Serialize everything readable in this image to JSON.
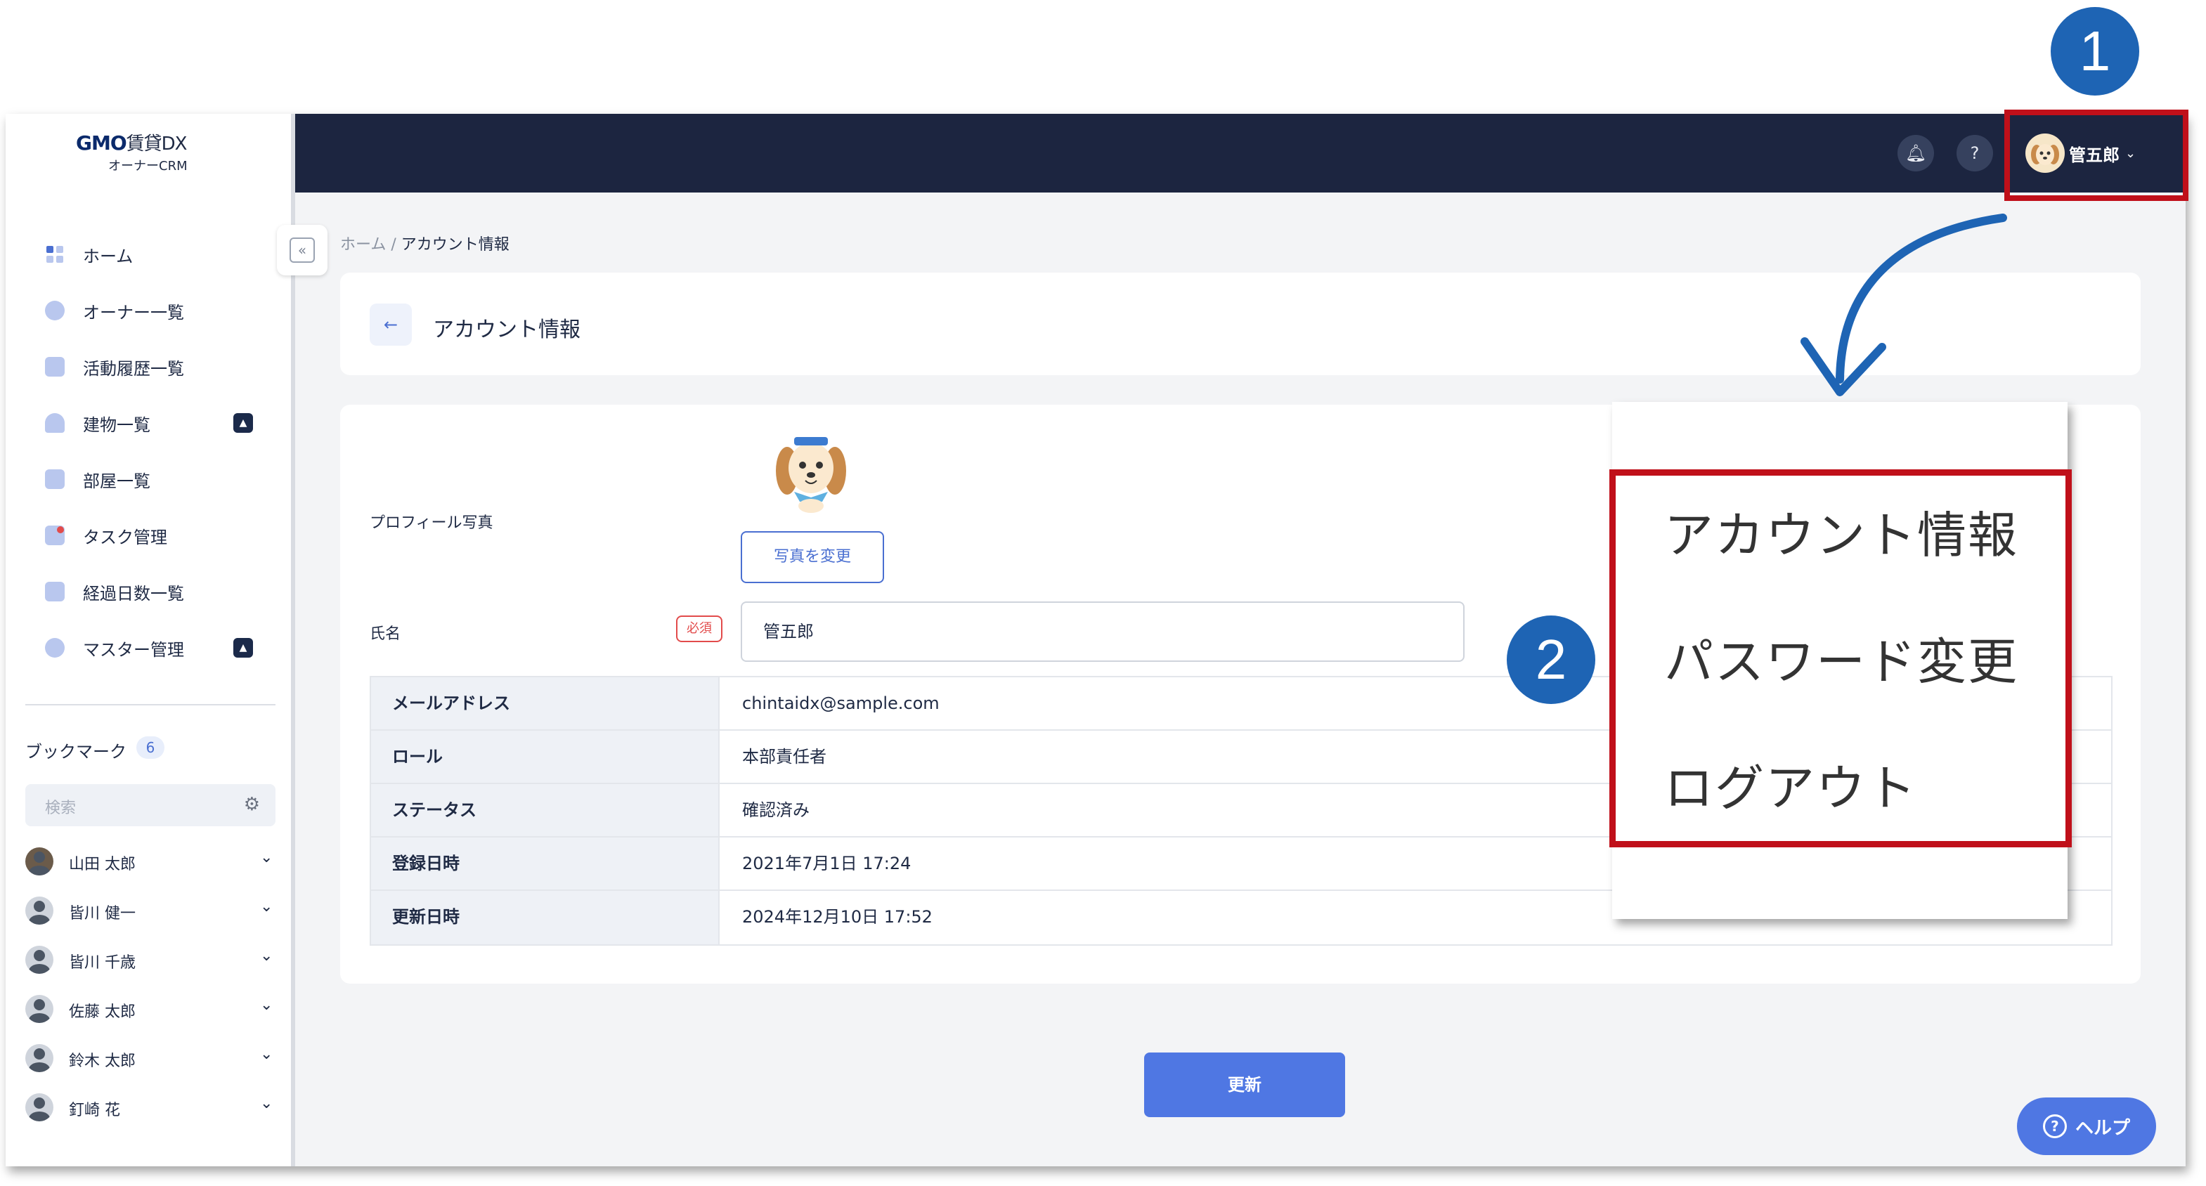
{
  "logo": {
    "brand": "GMO",
    "product": "賃貸DX",
    "sub": "オーナーCRM"
  },
  "sidebar": {
    "items": [
      {
        "label": "ホーム",
        "icon": "home-grid-icon"
      },
      {
        "label": "オーナー一覧",
        "icon": "person-icon"
      },
      {
        "label": "活動履歴一覧",
        "icon": "document-list-icon"
      },
      {
        "label": "建物一覧",
        "icon": "building-icon",
        "expandable": true
      },
      {
        "label": "部屋一覧",
        "icon": "room-icon"
      },
      {
        "label": "タスク管理",
        "icon": "task-icon"
      },
      {
        "label": "経過日数一覧",
        "icon": "checklist-icon"
      },
      {
        "label": "マスター管理",
        "icon": "settings-icon",
        "expandable": true
      }
    ],
    "bookmarks": {
      "title": "ブックマーク",
      "count": "6",
      "search_placeholder": "検索",
      "people": [
        "山田 太郎",
        "皆川 健一",
        "皆川 千歳",
        "佐藤 太郎",
        "鈴木 太郎",
        "釘崎 花"
      ]
    }
  },
  "header": {
    "user_name": "管五郎"
  },
  "breadcrumb": {
    "home": "ホーム",
    "separator": " / ",
    "current": "アカウント情報"
  },
  "page": {
    "title": "アカウント情報"
  },
  "form": {
    "photo_label": "プロフィール写真",
    "change_photo": "写真を変更",
    "name_label": "氏名",
    "required": "必須",
    "name_value": "管五郎",
    "rows": [
      {
        "key": "メールアドレス",
        "value": "chintaidx@sample.com"
      },
      {
        "key": "ロール",
        "value": "本部責任者"
      },
      {
        "key": "ステータス",
        "value": "確認済み"
      },
      {
        "key": "登録日時",
        "value": "2021年7月1日 17:24"
      },
      {
        "key": "更新日時",
        "value": "2024年12月10日 17:52"
      }
    ]
  },
  "buttons": {
    "update": "更新",
    "help": "ヘルプ"
  },
  "annotations": {
    "step1": "1",
    "step2": "2",
    "menu": [
      "アカウント情報",
      "パスワード変更",
      "ログアウト"
    ],
    "highlight_color": "#c0101a",
    "step_color": "#1e64b4"
  }
}
